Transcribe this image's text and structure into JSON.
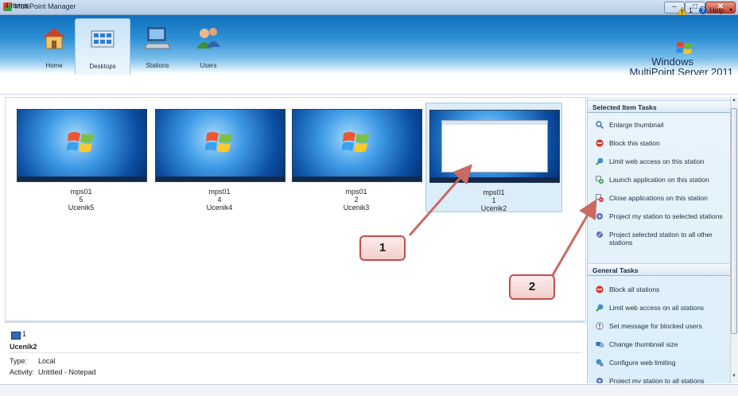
{
  "window": {
    "title": "MultiPoint Manager",
    "min_glyph": "–",
    "max_glyph": "□",
    "close_glyph": "✕"
  },
  "nav": {
    "tabs": [
      {
        "label": "Home",
        "icon": "house-icon"
      },
      {
        "label": "Desktops",
        "icon": "desktops-icon",
        "selected": true
      },
      {
        "label": "Stations",
        "icon": "stations-icon"
      },
      {
        "label": "Users",
        "icon": "users-icon"
      }
    ]
  },
  "brand": {
    "line1": "Windows",
    "line2": "MultiPoint Server 2011"
  },
  "status": {
    "warning_count": "1",
    "help_label": "Help",
    "help_arrow": "▾"
  },
  "thumbnails": [
    {
      "host": "mps01",
      "station": "5",
      "user": "Ucenik5",
      "screen": "desktop"
    },
    {
      "host": "mps01",
      "station": "4",
      "user": "Ucenik4",
      "screen": "desktop"
    },
    {
      "host": "mps01",
      "station": "2",
      "user": "Ucenik3",
      "screen": "desktop"
    },
    {
      "host": "mps01",
      "station": "1",
      "user": "Ucenik2",
      "screen": "notepad",
      "selected": true
    }
  ],
  "details": {
    "station_number": "1",
    "user": "Ucenik2",
    "type_label": "Type:",
    "type_value": "Local",
    "activity_label": "Activity:",
    "activity_value": "Untitled - Notepad"
  },
  "statusbar": {
    "items": "4 Items"
  },
  "taskpane": {
    "selected_header": "Selected Item Tasks",
    "selected_tasks": [
      {
        "label": "Enlarge thumbnail",
        "icon": "magnifier-icon"
      },
      {
        "label": "Block this station",
        "icon": "block-icon"
      },
      {
        "label": "Limit web access on this station",
        "icon": "web-limit-icon"
      },
      {
        "label": "Launch application on this station",
        "icon": "launch-app-icon"
      },
      {
        "label": "Close applications on this station",
        "icon": "close-app-icon"
      },
      {
        "label": "Project my station to selected stations",
        "icon": "project-icon"
      },
      {
        "label": "Project selected station to all other stations",
        "icon": "project-all-icon"
      }
    ],
    "general_header": "General Tasks",
    "general_tasks": [
      {
        "label": "Block all stations",
        "icon": "block-icon"
      },
      {
        "label": "Limit web access on all stations",
        "icon": "web-limit-icon"
      },
      {
        "label": "Set message for blocked users",
        "icon": "info-icon"
      },
      {
        "label": "Change thumbnail size",
        "icon": "thumbnail-size-icon"
      },
      {
        "label": "Configure web limiting",
        "icon": "web-config-icon"
      },
      {
        "label": "Project my station to all stations",
        "icon": "project-icon"
      }
    ]
  },
  "callouts": {
    "one": "1",
    "two": "2"
  },
  "colors": {
    "ribbon": "#0f6fbd",
    "callout_border": "#c0504d",
    "arrow": "#c96a62",
    "block_red": "#d9352b"
  }
}
